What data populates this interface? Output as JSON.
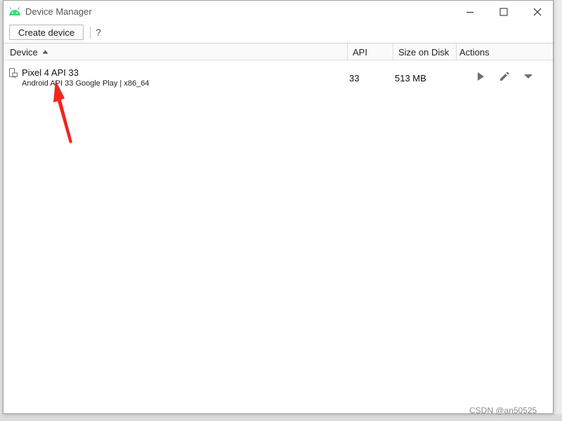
{
  "window": {
    "title": "Device Manager",
    "controls": {
      "minimize": "minimize",
      "maximize": "maximize",
      "close": "close"
    }
  },
  "toolbar": {
    "create_label": "Create device",
    "help_label": "?"
  },
  "table": {
    "columns": [
      "Device",
      "API",
      "Size on Disk",
      "Actions"
    ],
    "sort": "ascending",
    "rows": [
      {
        "name": "Pixel 4 API 33",
        "details": "Android API 33 Google Play | x86_64",
        "api": "33",
        "size": "513 MB"
      }
    ]
  },
  "icons": {
    "app": "android-icon",
    "device": "phone-icon",
    "launch": "play-icon",
    "edit": "pencil-icon",
    "more": "dropdown-arrow-icon"
  },
  "colors": {
    "android_green": "#3ddc84",
    "annotation_red": "#f0261e",
    "icon_gray": "#6e6e6e"
  },
  "watermark": "CSDN @an50525"
}
